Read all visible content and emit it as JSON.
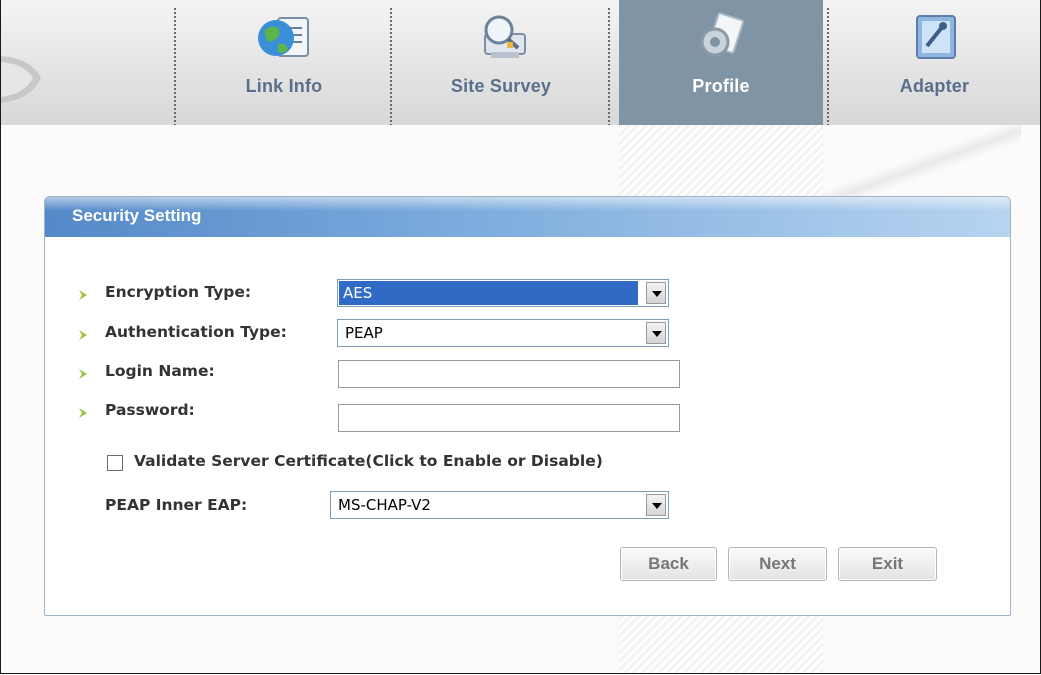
{
  "toolbar": {
    "tabs": [
      {
        "label": "Link Info",
        "icon": "link-info-icon"
      },
      {
        "label": "Site Survey",
        "icon": "site-survey-icon"
      },
      {
        "label": "Profile",
        "icon": "profile-icon"
      },
      {
        "label": "Adapter",
        "icon": "adapter-icon"
      }
    ],
    "active_tab": "Profile",
    "active_color": "#7f95a5"
  },
  "panel": {
    "title": "Security Setting",
    "header_color": "#5489c8"
  },
  "form": {
    "encryption_type": {
      "label": "Encryption Type:",
      "value": "AES"
    },
    "authentication_type": {
      "label": "Authentication Type:",
      "value": "PEAP"
    },
    "login_name": {
      "label": "Login Name:",
      "value": ""
    },
    "password": {
      "label": "Password:",
      "value": ""
    },
    "validate_cert": {
      "label": "Validate Server Certificate(Click to Enable or Disable)",
      "checked": false
    },
    "peap_inner_eap": {
      "label": "PEAP Inner EAP:",
      "value": "MS-CHAP-V2"
    }
  },
  "buttons": {
    "back": "Back",
    "next": "Next",
    "exit": "Exit"
  }
}
